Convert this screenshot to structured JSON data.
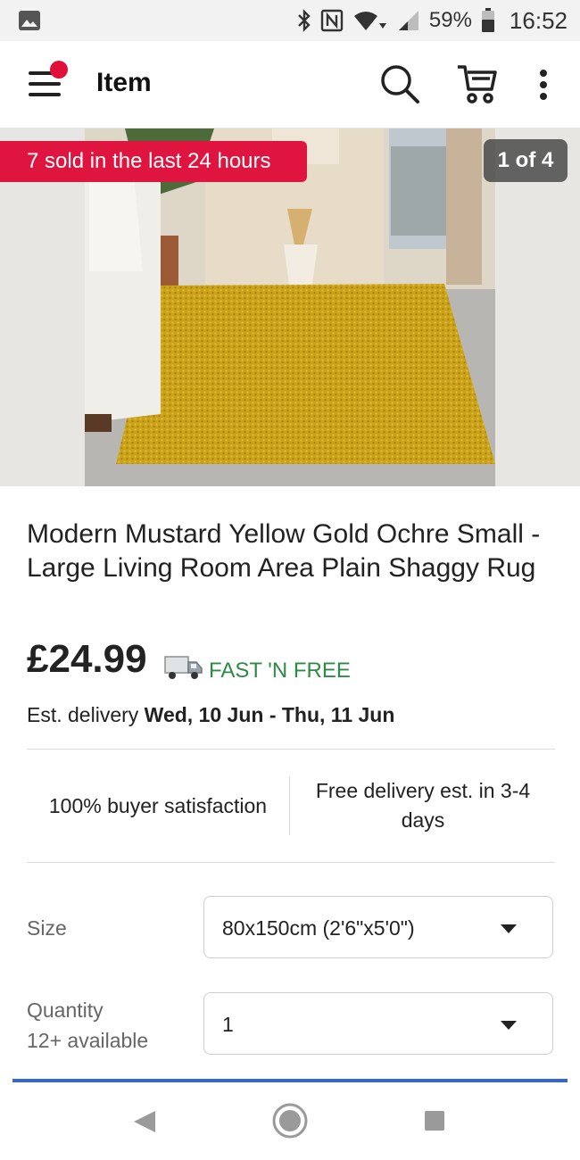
{
  "status_bar": {
    "battery_percent": "59%",
    "time": "16:52",
    "icons": [
      "image-icon",
      "bluetooth-icon",
      "nfc-icon",
      "wifi-icon",
      "signal-icon",
      "battery-icon"
    ]
  },
  "app_bar": {
    "title": "Item",
    "icons": [
      "menu-icon",
      "search-icon",
      "cart-icon",
      "more-vert-icon"
    ],
    "notification_dot_color": "#e0103a"
  },
  "hero": {
    "sold_badge": "7 sold in the last 24 hours",
    "image_counter": "1 of 4",
    "sold_badge_color": "#e0153f"
  },
  "item": {
    "title": "Modern Mustard Yellow Gold Ochre Small - Large Living Room Area Plain Shaggy Rug",
    "price": "£24.99",
    "shipping_badge": "FAST 'N FREE",
    "delivery_label": "Est. delivery",
    "delivery_dates": "Wed, 10 Jun - Thu, 11 Jun"
  },
  "highlights": {
    "satisfaction": "100% buyer satisfaction",
    "free_delivery": "Free delivery est. in 3-4 days"
  },
  "options": {
    "size_label": "Size",
    "size_value": "80x150cm (2'6\"x5'0\")",
    "quantity_label": "Quantity",
    "quantity_available": "12+ available",
    "quantity_value": "1"
  },
  "colors": {
    "accent_green": "#2f8a47",
    "accent_blue": "#3466d4"
  }
}
